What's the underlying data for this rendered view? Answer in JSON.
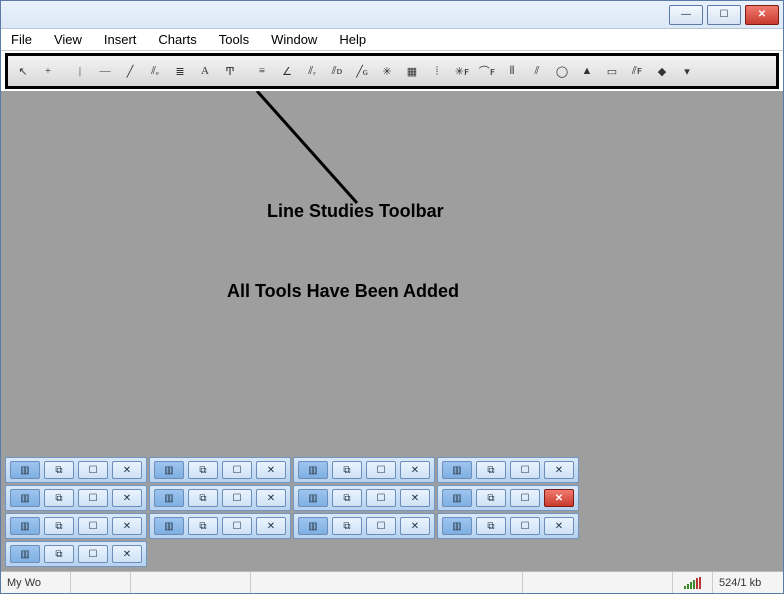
{
  "titlebar": {
    "min": "—",
    "max": "☐",
    "close": "✕"
  },
  "menu": [
    "File",
    "View",
    "Insert",
    "Charts",
    "Tools",
    "Window",
    "Help"
  ],
  "tools": [
    {
      "name": "cursor-icon",
      "glyph": "↖"
    },
    {
      "name": "crosshair-icon",
      "glyph": "+"
    },
    {
      "name": "sep",
      "glyph": ""
    },
    {
      "name": "vertical-line-icon",
      "glyph": "|"
    },
    {
      "name": "horizontal-line-icon",
      "glyph": "—"
    },
    {
      "name": "trendline-icon",
      "glyph": "╱"
    },
    {
      "name": "equidistant-channel-icon",
      "glyph": "⫽ₑ"
    },
    {
      "name": "fibonacci-retracement-icon",
      "glyph": "≣"
    },
    {
      "name": "text-icon",
      "glyph": "A"
    },
    {
      "name": "text-label-icon",
      "glyph": "Ͳ"
    },
    {
      "name": "sep",
      "glyph": ""
    },
    {
      "name": "equidistant-icon",
      "glyph": "≡"
    },
    {
      "name": "trendline-angle-icon",
      "glyph": "∠"
    },
    {
      "name": "regression-channel-icon",
      "glyph": "⫽ᵣ"
    },
    {
      "name": "stddev-channel-icon",
      "glyph": "⫽ᴅ"
    },
    {
      "name": "gann-line-icon",
      "glyph": "╱ɢ"
    },
    {
      "name": "gann-fan-icon",
      "glyph": "✳"
    },
    {
      "name": "gann-grid-icon",
      "glyph": "▦"
    },
    {
      "name": "fibo-time-icon",
      "glyph": "⦙"
    },
    {
      "name": "fibo-fan-icon",
      "glyph": "✳ꜰ"
    },
    {
      "name": "fibo-arc-icon",
      "glyph": "⌒ꜰ"
    },
    {
      "name": "fibo-channel-icon",
      "glyph": "⦀"
    },
    {
      "name": "fibo-expansion-icon",
      "glyph": "⫽"
    },
    {
      "name": "ellipse-icon",
      "glyph": "◯"
    },
    {
      "name": "triangle-icon",
      "glyph": "▲"
    },
    {
      "name": "rectangle-icon",
      "glyph": "▭"
    },
    {
      "name": "pitchfork-icon",
      "glyph": "⫽ꜰ"
    },
    {
      "name": "custom-icon",
      "glyph": "◆"
    },
    {
      "name": "dropdown-icon",
      "glyph": "▾"
    }
  ],
  "annotation": {
    "title": "Line Studies Toolbar",
    "subtitle": "All Tools Have Been Added"
  },
  "mdi": {
    "rows": [
      {
        "cols": 1,
        "active": false
      },
      {
        "cols": 4,
        "active": false
      },
      {
        "cols": 4,
        "active": true,
        "active_index": 3
      },
      {
        "cols": 4,
        "active": false
      }
    ],
    "btns": {
      "icon": "▥",
      "restore": "⧉",
      "max": "☐",
      "close": "✕"
    }
  },
  "status": {
    "left": "My Wo",
    "kb": "524/1 kb"
  }
}
